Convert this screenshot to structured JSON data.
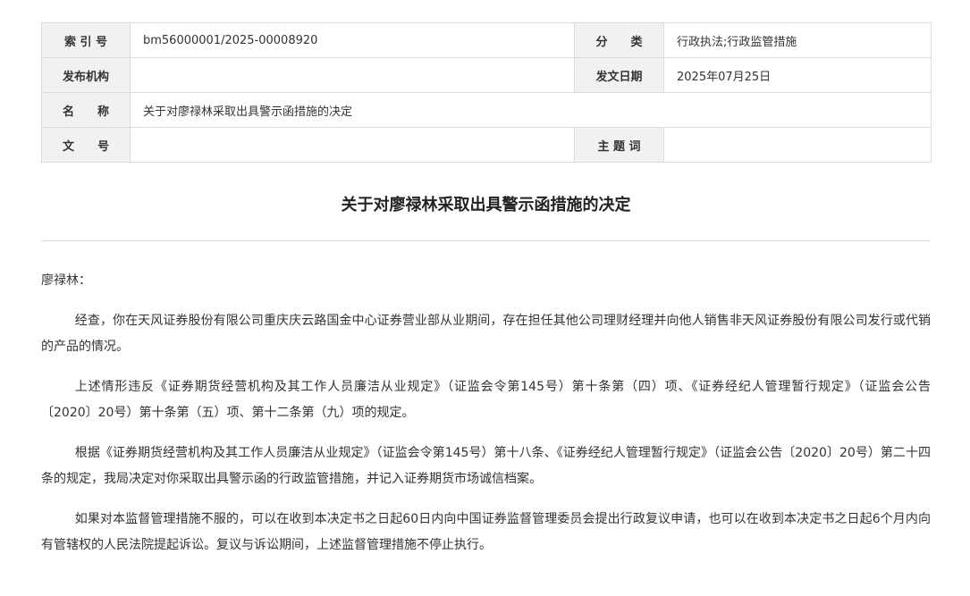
{
  "meta": {
    "index_label": "索 引 号",
    "index_value": "bm56000001/2025-00008920",
    "category_label": "分　　类",
    "category_value": "行政执法;行政监管措施",
    "publisher_label": "发布机构",
    "publisher_value": "",
    "date_label": "发文日期",
    "date_value": "2025年07月25日",
    "name_label": "名　　称",
    "name_value": "关于对廖禄林采取出具警示函措施的决定",
    "docno_label": "文　　号",
    "docno_value": "",
    "subject_label": "主 题 词",
    "subject_value": ""
  },
  "document": {
    "title": "关于对廖禄林采取出具警示函措施的决定",
    "greeting": "廖禄林：",
    "paragraphs": [
      "经查，你在天风证券股份有限公司重庆庆云路国金中心证券营业部从业期间，存在担任其他公司理财经理并向他人销售非天风证券股份有限公司发行或代销的产品的情况。",
      "上述情形违反《证券期货经营机构及其工作人员廉洁从业规定》（证监会令第145号）第十条第（四）项、《证券经纪人管理暂行规定》（证监会公告〔2020〕20号）第十条第（五）项、第十二条第（九）项的规定。",
      "根据《证券期货经营机构及其工作人员廉洁从业规定》（证监会令第145号）第十八条、《证券经纪人管理暂行规定》（证监会公告〔2020〕20号）第二十四条的规定，我局决定对你采取出具警示函的行政监管措施，并记入证券期货市场诚信档案。",
      "如果对本监督管理措施不服的，可以在收到本决定书之日起60日内向中国证券监督管理委员会提出行政复议申请，也可以在收到本决定书之日起6个月内向有管辖权的人民法院提起诉讼。复议与诉讼期间，上述监督管理措施不停止执行。"
    ]
  }
}
